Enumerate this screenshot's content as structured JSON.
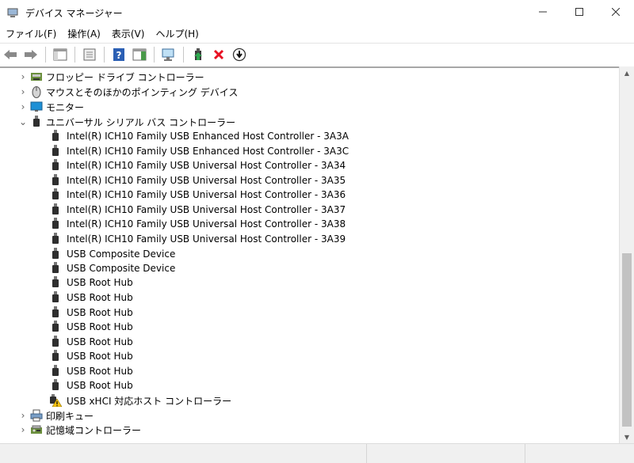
{
  "window": {
    "title": "デバイス マネージャー",
    "minimize": "—",
    "maximize": "☐",
    "close": "✕"
  },
  "menu": [
    {
      "label": "ファイル(F)"
    },
    {
      "label": "操作(A)"
    },
    {
      "label": "表示(V)"
    },
    {
      "label": "ヘルプ(H)"
    }
  ],
  "tree": {
    "categories_top": [
      {
        "label": "フロッピー ドライブ コントローラー",
        "icon": "floppy-controller-icon",
        "expander": "›"
      },
      {
        "label": "マウスとそのほかのポインティング デバイス",
        "icon": "mouse-icon",
        "expander": "›"
      },
      {
        "label": "モニター",
        "icon": "monitor-icon",
        "expander": "›"
      }
    ],
    "usb_category": {
      "label": "ユニバーサル シリアル バス コントローラー",
      "icon": "usb-plug-icon",
      "expander": "⌄"
    },
    "usb_children": [
      {
        "label": "Intel(R) ICH10 Family USB Enhanced Host Controller - 3A3A",
        "icon": "usb-plug-icon"
      },
      {
        "label": "Intel(R) ICH10 Family USB Enhanced Host Controller - 3A3C",
        "icon": "usb-plug-icon"
      },
      {
        "label": "Intel(R) ICH10 Family USB Universal Host Controller - 3A34",
        "icon": "usb-plug-icon"
      },
      {
        "label": "Intel(R) ICH10 Family USB Universal Host Controller - 3A35",
        "icon": "usb-plug-icon"
      },
      {
        "label": "Intel(R) ICH10 Family USB Universal Host Controller - 3A36",
        "icon": "usb-plug-icon"
      },
      {
        "label": "Intel(R) ICH10 Family USB Universal Host Controller - 3A37",
        "icon": "usb-plug-icon"
      },
      {
        "label": "Intel(R) ICH10 Family USB Universal Host Controller - 3A38",
        "icon": "usb-plug-icon"
      },
      {
        "label": "Intel(R) ICH10 Family USB Universal Host Controller - 3A39",
        "icon": "usb-plug-icon"
      },
      {
        "label": "USB Composite Device",
        "icon": "usb-plug-icon"
      },
      {
        "label": "USB Composite Device",
        "icon": "usb-plug-icon"
      },
      {
        "label": "USB Root Hub",
        "icon": "usb-plug-icon"
      },
      {
        "label": "USB Root Hub",
        "icon": "usb-plug-icon"
      },
      {
        "label": "USB Root Hub",
        "icon": "usb-plug-icon"
      },
      {
        "label": "USB Root Hub",
        "icon": "usb-plug-icon"
      },
      {
        "label": "USB Root Hub",
        "icon": "usb-plug-icon"
      },
      {
        "label": "USB Root Hub",
        "icon": "usb-plug-icon"
      },
      {
        "label": "USB Root Hub",
        "icon": "usb-plug-icon"
      },
      {
        "label": "USB Root Hub",
        "icon": "usb-plug-icon"
      },
      {
        "label": "USB xHCI 対応ホスト コントローラー",
        "icon": "warning-icon"
      }
    ],
    "categories_bottom": [
      {
        "label": "印刷キュー",
        "icon": "printer-icon",
        "expander": "›"
      },
      {
        "label": "記憶域コントローラー",
        "icon": "storage-controller-icon",
        "expander": "›"
      }
    ]
  },
  "colors": {
    "warning": "#f5c211",
    "delete_red": "#e81123",
    "help_blue": "#2b5fb4",
    "monitor_blue": "#1e90d6"
  }
}
